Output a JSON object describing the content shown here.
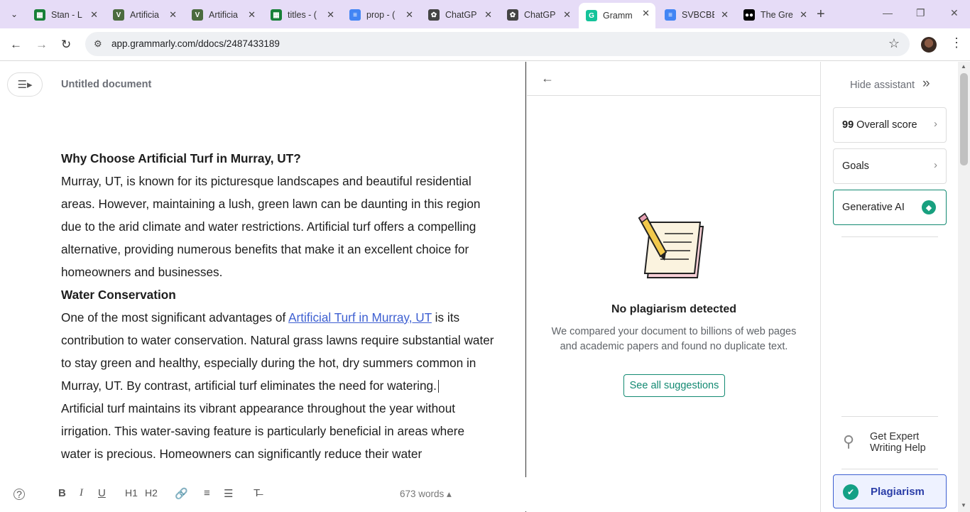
{
  "browser": {
    "tabs": [
      {
        "title": "Stan - L",
        "icon": "sheets-icon",
        "color": "#188038"
      },
      {
        "title": "Artificia",
        "icon": "vitality-icon",
        "color": "#4b6b3f"
      },
      {
        "title": "Artificia",
        "icon": "vitality-icon",
        "color": "#4b6b3f"
      },
      {
        "title": "titles - (",
        "icon": "sheets-icon",
        "color": "#188038"
      },
      {
        "title": "prop - (",
        "icon": "docs-icon",
        "color": "#4285f4"
      },
      {
        "title": "ChatGP",
        "icon": "openai-icon",
        "color": "#444444"
      },
      {
        "title": "ChatGP",
        "icon": "openai-icon",
        "color": "#444444"
      },
      {
        "title": "Gramm",
        "icon": "grammarly-icon",
        "color": "#15c39a"
      },
      {
        "title": "SVBCBE",
        "icon": "docs-icon",
        "color": "#4285f4"
      },
      {
        "title": "The Gre",
        "icon": "medium-icon",
        "color": "#000000"
      }
    ],
    "active_tab": 7,
    "url": "app.grammarly.com/ddocs/2487433189"
  },
  "editor": {
    "title": "Untitled document",
    "heading1": "Why Choose Artificial Turf in Murray, UT?",
    "para1": "Murray, UT, is known for its picturesque landscapes and beautiful residential areas. However, maintaining a lush, green lawn can be daunting in this region due to the arid climate and water restrictions. Artificial turf offers a compelling alternative, providing numerous benefits that make it an excellent choice for homeowners and businesses.",
    "heading2": "Water Conservation",
    "para2_before": "One of the most significant advantages of ",
    "para2_link": "Artificial Turf in Murray, UT",
    "para2_after": " is its contribution to water conservation. Natural grass lawns require substantial water to stay green and healthy, especially during the hot, dry summers common in Murray, UT. By contrast, artificial turf eliminates the need for watering.",
    "para3": "Artificial turf maintains its vibrant appearance throughout the year without irrigation. This water-saving feature is particularly beneficial in areas where water is precious. Homeowners can significantly reduce their water",
    "word_count": "673 words"
  },
  "toolbar": {
    "bold": "B",
    "italic": "I",
    "underline": "U",
    "h1": "H1",
    "h2": "H2"
  },
  "plagiarism": {
    "title": "No plagiarism detected",
    "description": "We compared your document to billions of web pages and academic papers and found no duplicate text.",
    "button": "See all suggestions"
  },
  "assistant": {
    "hide_label": "Hide assistant",
    "score_value": "99",
    "score_label": "Overall score",
    "goals_label": "Goals",
    "ai_label": "Generative AI",
    "expert_label": "Get Expert Writing Help",
    "plagiarism_label": "Plagiarism"
  }
}
